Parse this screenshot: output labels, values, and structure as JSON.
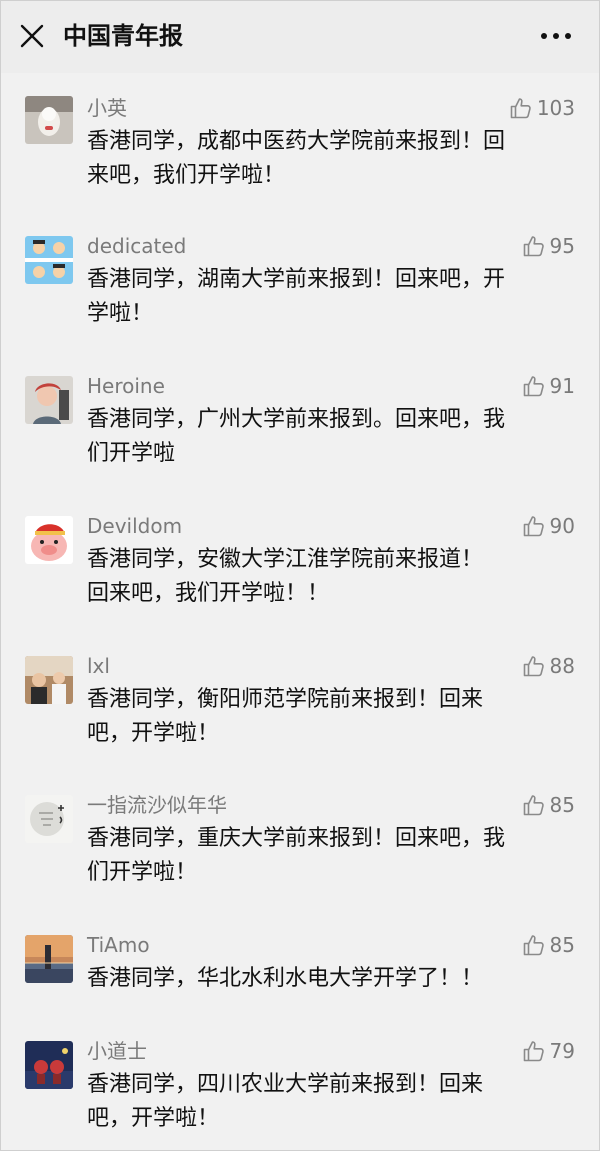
{
  "header": {
    "title": "中国青年报",
    "close_icon": "close-icon",
    "more_icon": "more-horizontal-icon"
  },
  "comments": [
    {
      "user": "小英",
      "likes": "103",
      "lines": [
        "香港同学，成都中医药大学院前来报到！回",
        "来吧，我们开学啦！"
      ],
      "avatar": "avatar-doll"
    },
    {
      "user": "dedicated",
      "likes": "95",
      "lines": [
        "香港同学，湖南大学前来报到！回来吧，开",
        "学啦！"
      ],
      "avatar": "avatar-cartoon-sky"
    },
    {
      "user": "Heroine",
      "likes": "91",
      "lines": [
        "香港同学，广州大学前来报到。回来吧，我",
        "们开学啦"
      ],
      "avatar": "avatar-person-portrait"
    },
    {
      "user": "Devildom",
      "likes": "90",
      "lines": [
        "香港同学，安徽大学江淮学院前来报道！",
        "回来吧，我们开学啦！！"
      ],
      "avatar": "avatar-cartoon-pig"
    },
    {
      "user": "lxl",
      "likes": "88",
      "lines": [
        "香港同学，衡阳师范学院前来报到！回来",
        "吧，开学啦！"
      ],
      "avatar": "avatar-photo-people"
    },
    {
      "user": "一指流沙似年华",
      "likes": "85",
      "lines": [
        "香港同学，重庆大学前来报到！回来吧，我",
        "们开学啦！"
      ],
      "avatar": "avatar-calligraphy-circle"
    },
    {
      "user": "TiAmo",
      "likes": "85",
      "lines": [
        "香港同学，华北水利水电大学开学了！！"
      ],
      "avatar": "avatar-sunset-tower"
    },
    {
      "user": "小道士",
      "likes": "79",
      "lines": [
        "香港同学，四川农业大学前来报到！回来",
        "吧，开学啦！"
      ],
      "avatar": "avatar-figures-dark"
    }
  ],
  "icons": {
    "like": "thumbs-up-icon"
  },
  "colors": {
    "background": "#ededed",
    "meta_text": "#7a7a7a",
    "body_text": "#111111"
  }
}
